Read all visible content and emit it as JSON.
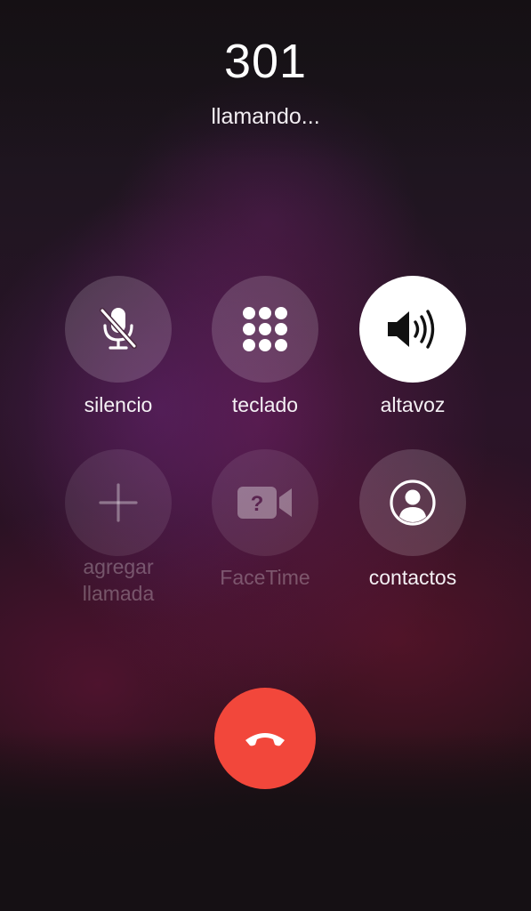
{
  "call": {
    "caller": "301",
    "status": "llamando..."
  },
  "buttons": [
    {
      "id": "mute",
      "label": "silencio",
      "icon": "microphone-slash-icon",
      "state": "off",
      "enabled": true
    },
    {
      "id": "keypad",
      "label": "teclado",
      "icon": "keypad-grid-icon",
      "state": "off",
      "enabled": true
    },
    {
      "id": "speaker",
      "label": "altavoz",
      "icon": "speaker-wave-icon",
      "state": "on",
      "enabled": true
    },
    {
      "id": "add-call",
      "label_line1": "agregar",
      "label_line2": "llamada",
      "icon": "plus-icon",
      "enabled": false
    },
    {
      "id": "facetime",
      "label": "FaceTime",
      "icon": "facetime-camera-icon",
      "enabled": false
    },
    {
      "id": "contacts",
      "label": "contactos",
      "icon": "contact-person-icon",
      "enabled": true
    }
  ],
  "end_call": {
    "icon": "phone-hangup-icon",
    "color": "#f2473b"
  },
  "colors": {
    "text": "#ffffff",
    "button_bg": "rgba(255,255,255,0.16)",
    "active_button_bg": "#ffffff",
    "disabled_text": "rgba(255,255,255,0.28)"
  }
}
